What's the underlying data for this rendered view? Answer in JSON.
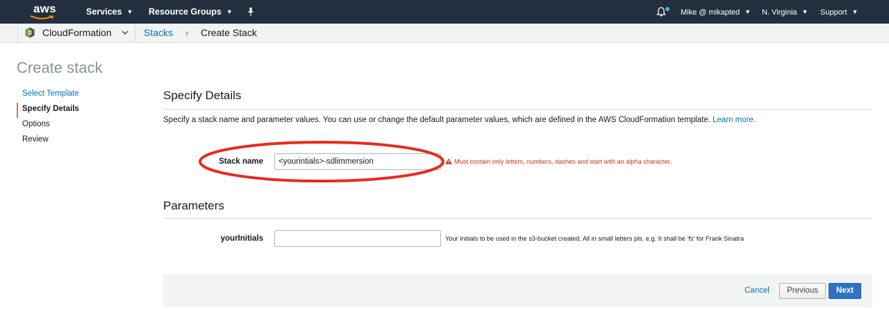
{
  "topnav": {
    "logo_text": "aws",
    "services_label": "Services",
    "resource_groups_label": "Resource Groups",
    "user_label": "Mike @ mikapted",
    "region_label": "N. Virginia",
    "support_label": "Support",
    "colors": {
      "background": "#232f3e",
      "logo_smile": "#ff9900",
      "notification_dot": "#44b9d6"
    }
  },
  "breadcrumb": {
    "service_label": "CloudFormation",
    "stacks_label": "Stacks",
    "separator": "›",
    "current_label": "Create Stack"
  },
  "page": {
    "title": "Create stack",
    "steps": [
      {
        "label": "Select Template",
        "state": "link"
      },
      {
        "label": "Specify Details",
        "state": "active"
      },
      {
        "label": "Options",
        "state": "plain"
      },
      {
        "label": "Review",
        "state": "plain"
      }
    ]
  },
  "details": {
    "heading": "Specify Details",
    "description": "Specify a stack name and parameter values. You can use or change the default parameter values, which are defined in the AWS CloudFormation template.",
    "learn_more": "Learn more.",
    "stack_name_label": "Stack name",
    "stack_name_value": "<yourintials>-sdlimmersion",
    "stack_name_error": "Must contain only letters, numbers, dashes and start with an alpha character."
  },
  "parameters": {
    "heading": "Parameters",
    "initials_label": "yourInitials",
    "initials_value": "",
    "initials_help": "Your Initials to be used in the s3-bucket created. All in small letters pls. e.g. It shall be 'fs' for Frank Sinatra"
  },
  "footer": {
    "cancel_label": "Cancel",
    "previous_label": "Previous",
    "next_label": "Next"
  },
  "colors": {
    "link": "#0073bb",
    "error": "#d13212",
    "active_step_marker": "#ec7211",
    "primary_button": "#2e73c4",
    "annotation_ellipse": "#e8291c"
  }
}
